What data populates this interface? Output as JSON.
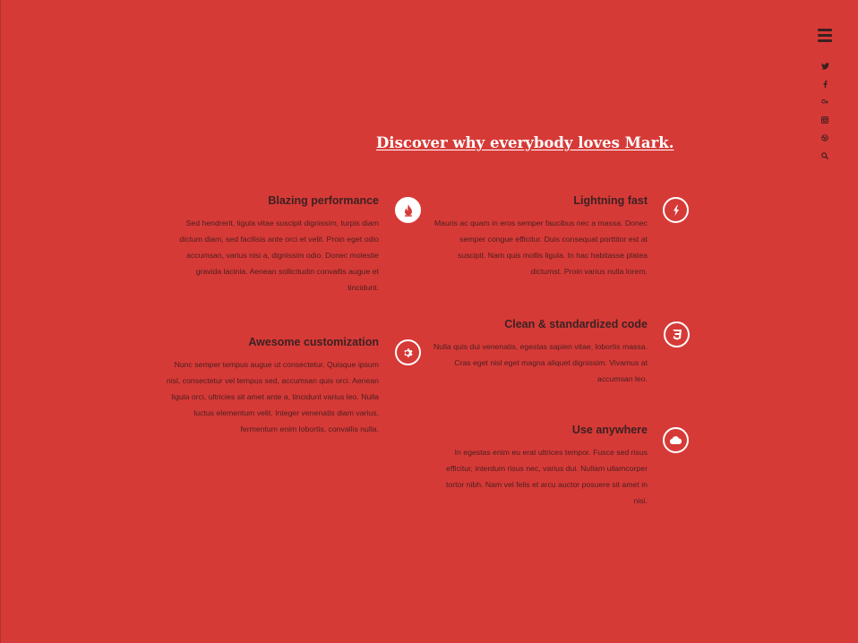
{
  "nav": {
    "menu_icon": "hamburger-icon",
    "social": [
      "twitter-icon",
      "facebook-icon",
      "google-plus-icon",
      "instagram-icon",
      "dribbble-icon",
      "search-icon"
    ]
  },
  "section": {
    "heading": "Discover why everybody loves Mark."
  },
  "features": [
    {
      "title": "Blazing performance",
      "text": "Sed hendrerit, ligula vitae suscipit dignissim, turpis diam dictum diam, sed facilisis ante orci et velit. Proin eget odio accumsan, varius nisi a, dignissim odio. Donec molestie gravida lacinia. Aenean sollicitudin convallis augue et tincidunt.",
      "icon": "flame-icon"
    },
    {
      "title": "Lightning fast",
      "text": "Mauris ac quam in eros semper faucibus nec a massa. Donec semper congue efficitur. Duis consequat porttitor est at suscipit. Nam quis mollis ligula. In hac habitasse platea dictumst. Proin varius nulla lorem.",
      "icon": "lightning-icon"
    },
    {
      "title": "Clean & standardized code",
      "text": "Nulla quis dui venenatis, egestas sapien vitae, lobortis massa. Cras eget nisl eget magna aliquet dignissim. Vivamus at accumsan leo.",
      "icon": "css3-icon"
    },
    {
      "title": "Awesome customization",
      "text": "Nunc semper tempus augue ut consectetur. Quisque ipsum nisl, consectetur vel tempus sed, accumsan quis orci. Aenean ligula orci, ultricies sit amet ante a, tincidunt varius leo. Nulla luctus elementum velit. Integer venenatis diam varius, fermentum enim lobortis, convallis nulla.",
      "icon": "gear-icon"
    },
    {
      "title": "Use anywhere",
      "text": "In egestas enim eu erat ultrices tempor. Fusce sed risus efficitur, interdum risus nec, varius dui. Nullam ullamcorper tortor nibh. Nam vel felis et arcu auctor posuere sit amet in nisi.",
      "icon": "cloud-icon"
    }
  ]
}
